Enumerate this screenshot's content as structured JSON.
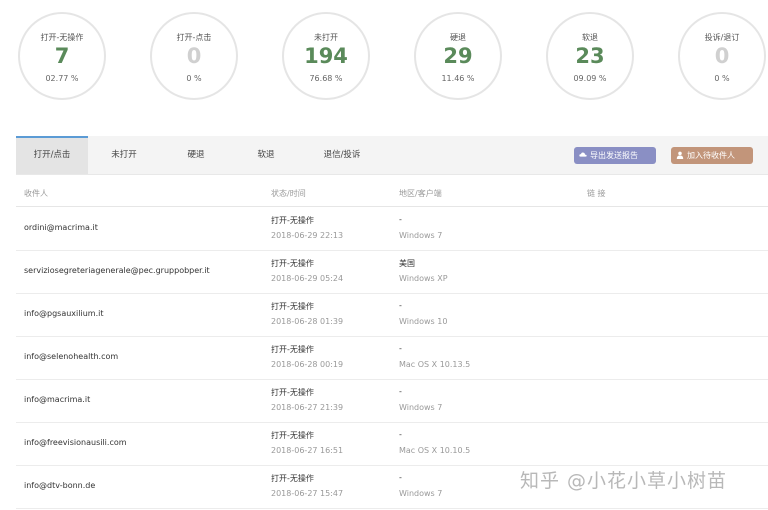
{
  "stats": [
    {
      "label": "打开-无操作",
      "value": "7",
      "pct": "02.77 %",
      "zero": false
    },
    {
      "label": "打开-点击",
      "value": "0",
      "pct": "0 %",
      "zero": true
    },
    {
      "label": "未打开",
      "value": "194",
      "pct": "76.68 %",
      "zero": false
    },
    {
      "label": "硬退",
      "value": "29",
      "pct": "11.46 %",
      "zero": false
    },
    {
      "label": "软退",
      "value": "23",
      "pct": "09.09 %",
      "zero": false
    },
    {
      "label": "投诉/退订",
      "value": "0",
      "pct": "0 %",
      "zero": true
    }
  ],
  "tabs": [
    "打开/点击",
    "未打开",
    "硬退",
    "软退",
    "退信/投诉"
  ],
  "active_tab": "打开/点击",
  "buttons": {
    "export": "导出发送报告",
    "blacklist": "加入待收件人"
  },
  "table": {
    "headers": {
      "recipient": "收件人",
      "status_time": "状态/时间",
      "region_client": "地区/客户端",
      "link": "链 接"
    },
    "rows": [
      {
        "email": "ordini@macrima.it",
        "status": "打开-无操作",
        "time": "2018-06-29 22:13",
        "region": "-",
        "client": "Windows 7"
      },
      {
        "email": "serviziosegreteriagenerale@pec.gruppobper.it",
        "status": "打开-无操作",
        "time": "2018-06-29 05:24",
        "region": "美国",
        "client": "Windows XP"
      },
      {
        "email": "info@pgsauxilium.it",
        "status": "打开-无操作",
        "time": "2018-06-28 01:39",
        "region": "-",
        "client": "Windows 10"
      },
      {
        "email": "info@selenohealth.com",
        "status": "打开-无操作",
        "time": "2018-06-28 00:19",
        "region": "-",
        "client": "Mac OS X 10.13.5"
      },
      {
        "email": "info@macrima.it",
        "status": "打开-无操作",
        "time": "2018-06-27 21:39",
        "region": "-",
        "client": "Windows 7"
      },
      {
        "email": "info@freevisionausili.com",
        "status": "打开-无操作",
        "time": "2018-06-27 16:51",
        "region": "-",
        "client": "Mac OS X 10.10.5"
      },
      {
        "email": "info@dtv-bonn.de",
        "status": "打开-无操作",
        "time": "2018-06-27 15:47",
        "region": "-",
        "client": "Windows 7"
      }
    ]
  },
  "watermark": "知乎 @小花小草小树苗",
  "colors": {
    "accent_green": "#5a8a5a",
    "tab_accent": "#5b9bd5",
    "export_btn": "#8a8fc4",
    "blacklist_btn": "#c2957a"
  }
}
